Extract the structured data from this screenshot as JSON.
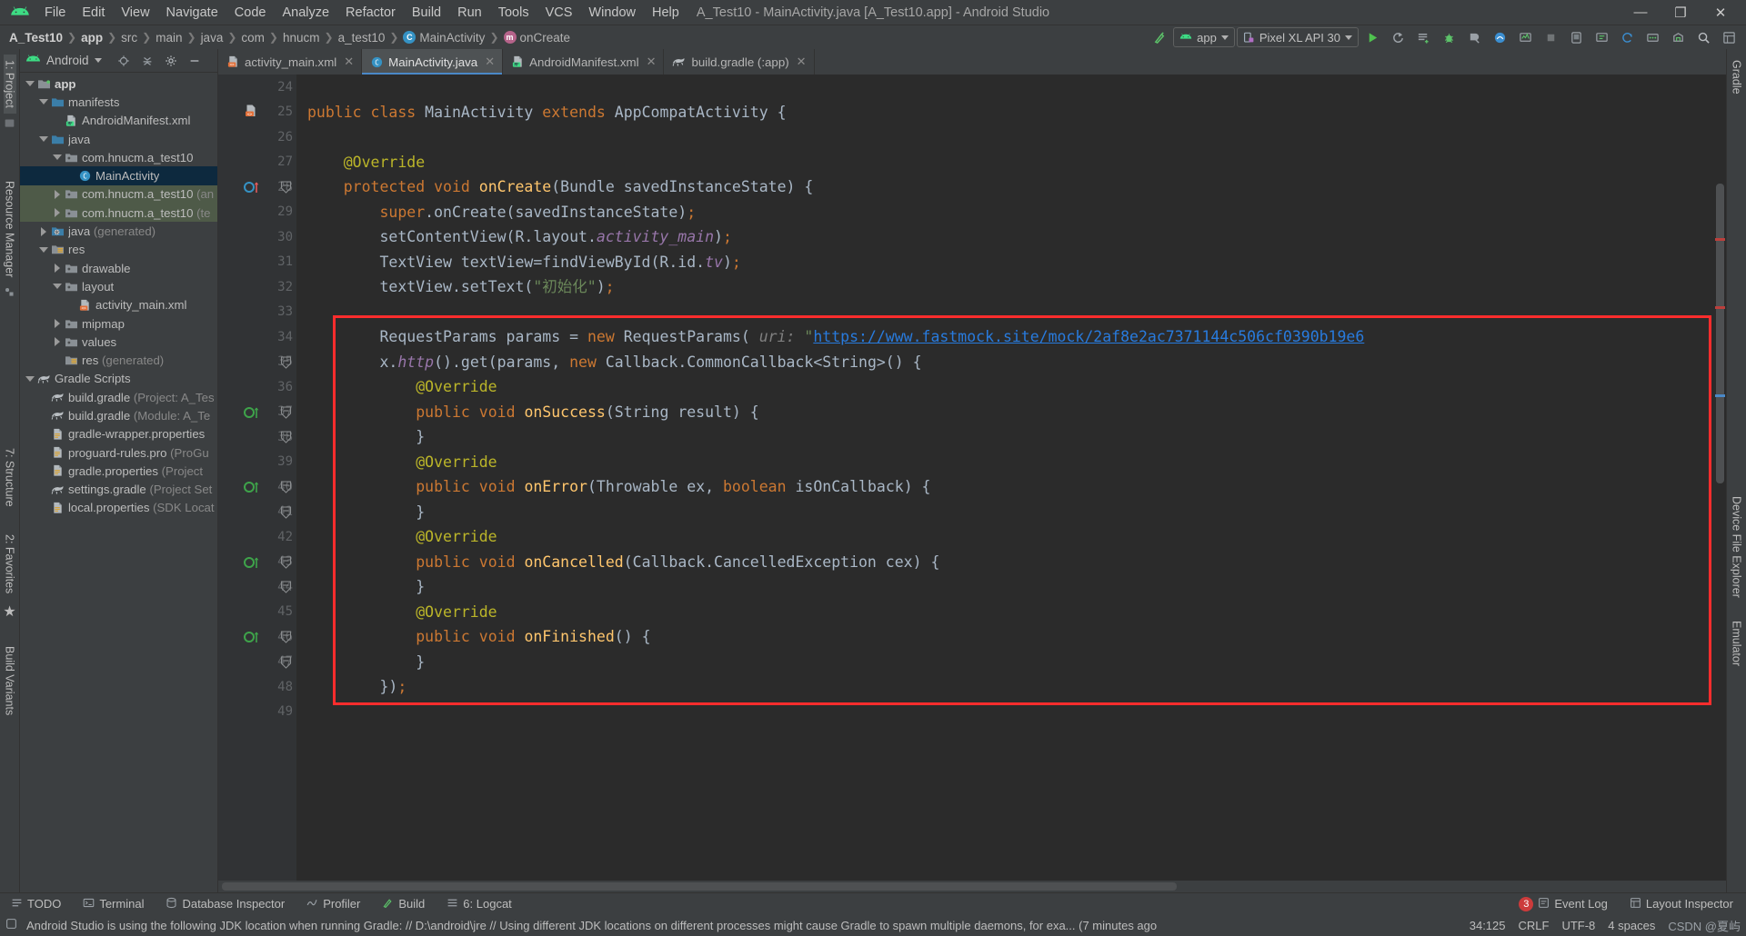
{
  "window": {
    "title": "A_Test10 - MainActivity.java [A_Test10.app] - Android Studio",
    "minimize": "—",
    "maximize": "❐",
    "close": "✕"
  },
  "menu": [
    {
      "label": "File"
    },
    {
      "label": "Edit"
    },
    {
      "label": "View"
    },
    {
      "label": "Navigate"
    },
    {
      "label": "Code"
    },
    {
      "label": "Analyze"
    },
    {
      "label": "Refactor"
    },
    {
      "label": "Build"
    },
    {
      "label": "Run"
    },
    {
      "label": "Tools"
    },
    {
      "label": "VCS"
    },
    {
      "label": "Window"
    },
    {
      "label": "Help"
    }
  ],
  "breadcrumb": [
    {
      "label": "A_Test10",
      "bold": true
    },
    {
      "label": "app",
      "bold": true
    },
    {
      "label": "src"
    },
    {
      "label": "main"
    },
    {
      "label": "java"
    },
    {
      "label": "com"
    },
    {
      "label": "hnucm"
    },
    {
      "label": "a_test10"
    },
    {
      "label": "MainActivity",
      "icon": "class-icon"
    },
    {
      "label": "onCreate",
      "icon": "method-icon"
    }
  ],
  "toolbar": {
    "module_selector": "app",
    "device_selector": "Pixel XL API 30",
    "run_tooltip": "Run",
    "icons": [
      "build-icon",
      "run-icon",
      "rerun-icon",
      "apply-changes-icon",
      "debug-icon",
      "profile-icon",
      "monitor-icon",
      "layout-inspector-icon",
      "stop-icon",
      "avd-manager-icon",
      "sdk-manager-icon",
      "sync-gradle-icon",
      "search-icon"
    ]
  },
  "left_rail": [
    {
      "label": "1: Project",
      "selected": true
    },
    {
      "label": "Resource Manager",
      "selected": false
    },
    {
      "label": "7: Structure",
      "selected": false
    },
    {
      "label": "2: Favorites",
      "selected": false
    },
    {
      "label": "Build Variants",
      "selected": false
    }
  ],
  "right_rail": [
    {
      "label": "Gradle"
    },
    {
      "label": "Device File Explorer"
    },
    {
      "label": "Emulator"
    }
  ],
  "project_panel": {
    "title": "Android",
    "tree": [
      {
        "indent": 0,
        "arrow": "down",
        "icon": "module-folder-icon",
        "label": "app",
        "bold": true,
        "sub": ""
      },
      {
        "indent": 1,
        "arrow": "down",
        "icon": "folder-icon",
        "label": "manifests",
        "sub": ""
      },
      {
        "indent": 2,
        "arrow": "none",
        "icon": "manifest-file-icon",
        "label": "AndroidManifest.xml",
        "sub": ""
      },
      {
        "indent": 1,
        "arrow": "down",
        "icon": "folder-icon",
        "label": "java",
        "sub": ""
      },
      {
        "indent": 2,
        "arrow": "down",
        "icon": "package-icon",
        "label": "com.hnucm.a_test10",
        "sub": ""
      },
      {
        "indent": 3,
        "arrow": "none",
        "icon": "class-icon",
        "label": "MainActivity",
        "sub": "",
        "state": "selected"
      },
      {
        "indent": 2,
        "arrow": "right",
        "icon": "package-icon",
        "label": "com.hnucm.a_test10",
        "sub": "(an",
        "state": "green"
      },
      {
        "indent": 2,
        "arrow": "right",
        "icon": "package-icon",
        "label": "com.hnucm.a_test10",
        "sub": "(te",
        "state": "green"
      },
      {
        "indent": 1,
        "arrow": "right",
        "icon": "generated-folder-icon",
        "label": "java",
        "sub": "(generated)"
      },
      {
        "indent": 1,
        "arrow": "down",
        "icon": "res-folder-icon",
        "label": "res",
        "sub": ""
      },
      {
        "indent": 2,
        "arrow": "right",
        "icon": "package-icon",
        "label": "drawable",
        "sub": ""
      },
      {
        "indent": 2,
        "arrow": "down",
        "icon": "package-icon",
        "label": "layout",
        "sub": ""
      },
      {
        "indent": 3,
        "arrow": "none",
        "icon": "xml-file-icon",
        "label": "activity_main.xml",
        "sub": ""
      },
      {
        "indent": 2,
        "arrow": "right",
        "icon": "package-icon",
        "label": "mipmap",
        "sub": ""
      },
      {
        "indent": 2,
        "arrow": "right",
        "icon": "package-icon",
        "label": "values",
        "sub": ""
      },
      {
        "indent": 2,
        "arrow": "none",
        "icon": "res-folder-icon",
        "label": "res",
        "sub": "(generated)"
      },
      {
        "indent": 0,
        "arrow": "down",
        "icon": "gradle-icon",
        "label": "Gradle Scripts",
        "sub": ""
      },
      {
        "indent": 1,
        "arrow": "none",
        "icon": "gradle-icon",
        "label": "build.gradle",
        "sub": "(Project: A_Tes"
      },
      {
        "indent": 1,
        "arrow": "none",
        "icon": "gradle-icon",
        "label": "build.gradle",
        "sub": "(Module: A_Te"
      },
      {
        "indent": 1,
        "arrow": "none",
        "icon": "properties-icon",
        "label": "gradle-wrapper.properties",
        "sub": ""
      },
      {
        "indent": 1,
        "arrow": "none",
        "icon": "properties-icon",
        "label": "proguard-rules.pro",
        "sub": "(ProGu"
      },
      {
        "indent": 1,
        "arrow": "none",
        "icon": "properties-icon",
        "label": "gradle.properties",
        "sub": "(Project "
      },
      {
        "indent": 1,
        "arrow": "none",
        "icon": "gradle-icon",
        "label": "settings.gradle",
        "sub": "(Project Set"
      },
      {
        "indent": 1,
        "arrow": "none",
        "icon": "properties-icon",
        "label": "local.properties",
        "sub": "(SDK Locat"
      }
    ]
  },
  "editor_tabs": [
    {
      "label": "activity_main.xml",
      "icon": "xml-file-icon",
      "active": false
    },
    {
      "label": "MainActivity.java",
      "icon": "class-icon",
      "active": true
    },
    {
      "label": "AndroidManifest.xml",
      "icon": "manifest-file-icon",
      "active": false
    },
    {
      "label": "build.gradle (:app)",
      "icon": "gradle-icon",
      "active": false
    }
  ],
  "code": {
    "first_line": 24,
    "lines": [
      {
        "n": 24,
        "tokens": []
      },
      {
        "n": 25,
        "marker": "class-file-icon",
        "tokens": [
          {
            "t": "public ",
            "c": "kw"
          },
          {
            "t": "class ",
            "c": "kw"
          },
          {
            "t": "MainActivity ",
            "c": "ty"
          },
          {
            "t": "extends ",
            "c": "kw"
          },
          {
            "t": "AppCompatActivity ",
            "c": "ty"
          },
          {
            "t": "{",
            "c": "id"
          }
        ]
      },
      {
        "n": 26,
        "tokens": []
      },
      {
        "n": 27,
        "tokens": [
          {
            "t": "    @Override",
            "c": "an"
          }
        ]
      },
      {
        "n": 28,
        "marker": "override-icon",
        "fold": true,
        "tokens": [
          {
            "t": "    ",
            "c": "id"
          },
          {
            "t": "protected ",
            "c": "kw"
          },
          {
            "t": "void ",
            "c": "kw"
          },
          {
            "t": "onCreate",
            "c": "fn"
          },
          {
            "t": "(Bundle savedInstanceState) {",
            "c": "id"
          }
        ]
      },
      {
        "n": 29,
        "tokens": [
          {
            "t": "        ",
            "c": "id"
          },
          {
            "t": "super",
            "c": "kw"
          },
          {
            "t": ".onCreate(savedInstanceState)",
            "c": "id"
          },
          {
            "t": ";",
            "c": "kw"
          }
        ]
      },
      {
        "n": 30,
        "tokens": [
          {
            "t": "        setContentView(R.layout.",
            "c": "id"
          },
          {
            "t": "activity_main",
            "c": "fld"
          },
          {
            "t": ")",
            "c": "id"
          },
          {
            "t": ";",
            "c": "kw"
          }
        ]
      },
      {
        "n": 31,
        "tokens": [
          {
            "t": "        TextView textView=findViewById(R.id.",
            "c": "id"
          },
          {
            "t": "tv",
            "c": "fld"
          },
          {
            "t": ")",
            "c": "id"
          },
          {
            "t": ";",
            "c": "kw"
          }
        ]
      },
      {
        "n": 32,
        "tokens": [
          {
            "t": "        textView.setText(",
            "c": "id"
          },
          {
            "t": "\"初始化\"",
            "c": "str"
          },
          {
            "t": ")",
            "c": "id"
          },
          {
            "t": ";",
            "c": "kw"
          }
        ]
      },
      {
        "n": 33,
        "tokens": []
      },
      {
        "n": 34,
        "in_box": true,
        "tokens": [
          {
            "t": "        RequestParams params = ",
            "c": "id"
          },
          {
            "t": "new ",
            "c": "kw"
          },
          {
            "t": "RequestParams(",
            "c": "id"
          },
          {
            "t": " uri: ",
            "c": "hint"
          },
          {
            "t": "\"",
            "c": "str"
          },
          {
            "t": "https://www.fastmock.site/mock/2af8e2ac7371144c506cf0390b19e6",
            "c": "lnk"
          }
        ]
      },
      {
        "n": 35,
        "in_box": true,
        "fold": true,
        "tokens": [
          {
            "t": "        x.",
            "c": "id"
          },
          {
            "t": "http",
            "c": "fld"
          },
          {
            "t": "().get(params, ",
            "c": "id"
          },
          {
            "t": "new ",
            "c": "kw"
          },
          {
            "t": "Callback.CommonCallback<String>() {",
            "c": "id"
          }
        ]
      },
      {
        "n": 36,
        "in_box": true,
        "tokens": [
          {
            "t": "            @Override",
            "c": "an"
          }
        ]
      },
      {
        "n": 37,
        "in_box": true,
        "marker": "impl-icon",
        "fold": true,
        "tokens": [
          {
            "t": "            ",
            "c": "id"
          },
          {
            "t": "public ",
            "c": "kw"
          },
          {
            "t": "void ",
            "c": "kw"
          },
          {
            "t": "onSuccess",
            "c": "fn"
          },
          {
            "t": "(String result) {",
            "c": "id"
          }
        ]
      },
      {
        "n": 38,
        "in_box": true,
        "fold": true,
        "tokens": [
          {
            "t": "            }",
            "c": "id"
          }
        ]
      },
      {
        "n": 39,
        "in_box": true,
        "tokens": [
          {
            "t": "            @Override",
            "c": "an"
          }
        ]
      },
      {
        "n": 40,
        "in_box": true,
        "marker": "impl-icon",
        "fold": true,
        "tokens": [
          {
            "t": "            ",
            "c": "id"
          },
          {
            "t": "public ",
            "c": "kw"
          },
          {
            "t": "void ",
            "c": "kw"
          },
          {
            "t": "onError",
            "c": "fn"
          },
          {
            "t": "(Throwable ex, ",
            "c": "id"
          },
          {
            "t": "boolean ",
            "c": "kw"
          },
          {
            "t": "isOnCallback) {",
            "c": "id"
          }
        ]
      },
      {
        "n": 41,
        "in_box": true,
        "fold": true,
        "tokens": [
          {
            "t": "            }",
            "c": "id"
          }
        ]
      },
      {
        "n": 42,
        "in_box": true,
        "tokens": [
          {
            "t": "            @Override",
            "c": "an"
          }
        ]
      },
      {
        "n": 43,
        "in_box": true,
        "marker": "impl-icon",
        "fold": true,
        "tokens": [
          {
            "t": "            ",
            "c": "id"
          },
          {
            "t": "public ",
            "c": "kw"
          },
          {
            "t": "void ",
            "c": "kw"
          },
          {
            "t": "onCancelled",
            "c": "fn"
          },
          {
            "t": "(Callback.CancelledException cex) {",
            "c": "id"
          }
        ]
      },
      {
        "n": 44,
        "in_box": true,
        "fold": true,
        "tokens": [
          {
            "t": "            }",
            "c": "id"
          }
        ]
      },
      {
        "n": 45,
        "in_box": true,
        "tokens": [
          {
            "t": "            @Override",
            "c": "an"
          }
        ]
      },
      {
        "n": 46,
        "in_box": true,
        "marker": "impl-icon",
        "fold": true,
        "tokens": [
          {
            "t": "            ",
            "c": "id"
          },
          {
            "t": "public ",
            "c": "kw"
          },
          {
            "t": "void ",
            "c": "kw"
          },
          {
            "t": "onFinished",
            "c": "fn"
          },
          {
            "t": "() {",
            "c": "id"
          }
        ]
      },
      {
        "n": 47,
        "in_box": true,
        "fold": true,
        "tokens": [
          {
            "t": "            }",
            "c": "id"
          }
        ]
      },
      {
        "n": 48,
        "in_box": true,
        "tokens": [
          {
            "t": "        })",
            "c": "id"
          },
          {
            "t": ";",
            "c": "kw"
          }
        ]
      },
      {
        "n": 49,
        "tokens": []
      }
    ]
  },
  "bottom_tools": [
    {
      "label": "TODO",
      "icon": "todo-icon"
    },
    {
      "label": "Terminal",
      "icon": "terminal-icon"
    },
    {
      "label": "Database Inspector",
      "icon": "database-icon"
    },
    {
      "label": "Profiler",
      "icon": "profiler-icon"
    },
    {
      "label": "Build",
      "icon": "build-icon"
    },
    {
      "label": "6: Logcat",
      "icon": "logcat-icon"
    }
  ],
  "bottom_tools_right": [
    {
      "label": "Event Log",
      "icon": "event-log-icon",
      "badge": "3"
    },
    {
      "label": "Layout Inspector",
      "icon": "layout-inspector-icon",
      "badge": ""
    }
  ],
  "statusbar": {
    "message": "Android Studio is using the following JDK location when running Gradle: // D:\\android\\jre // Using different JDK locations on different processes might cause Gradle to spawn multiple daemons, for exa... (7 minutes ago",
    "caret": "34:125",
    "line_separator": "CRLF",
    "encoding": "UTF-8",
    "indent": "4 spaces",
    "watermark": "CSDN @夏屿"
  },
  "colors": {
    "accent": "#4a88c7",
    "editor_bg": "#2b2b2b",
    "panel_bg": "#3c3f41",
    "gutter_bg": "#313335",
    "selection": "#0d293e",
    "green_row": "#4e5a48",
    "highlight_box": "#ff2d2d",
    "android_green": "#3ddc84"
  }
}
